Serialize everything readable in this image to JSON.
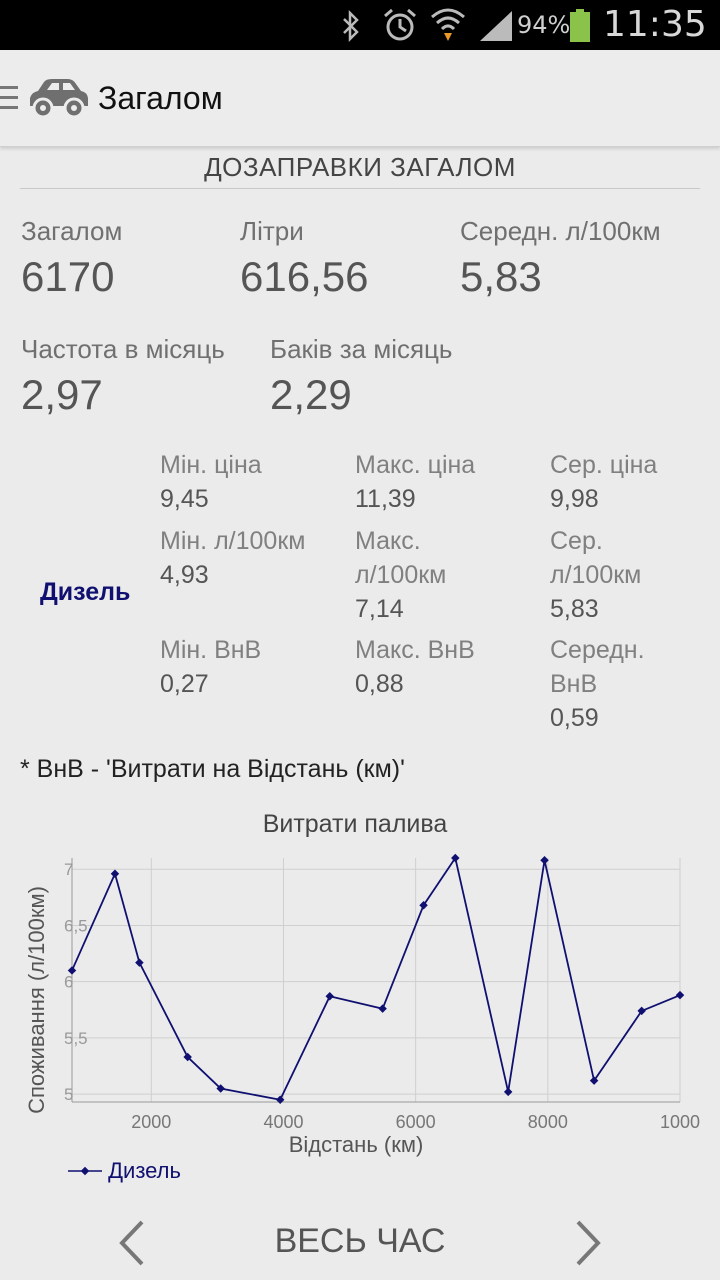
{
  "status_bar": {
    "icons": [
      "bluetooth-icon",
      "alarm-icon",
      "wifi-icon",
      "signal-icon",
      "battery-icon"
    ],
    "battery_percent": "94%",
    "time": "11:35",
    "battery_color": "#8bc34a"
  },
  "action_bar": {
    "title": "Загалом"
  },
  "summary": {
    "header": "ДОЗАПРАВКИ ЗАГАЛОМ",
    "stats": [
      {
        "label": "Загалом",
        "value": "6170"
      },
      {
        "label": "Літри",
        "value": "616,56"
      },
      {
        "label": "Середн. л/100км",
        "value": "5,83"
      },
      {
        "label": "Частота в місяць",
        "value": "2,97"
      },
      {
        "label": "Баків за місяць",
        "value": "2,29"
      }
    ]
  },
  "fuel": {
    "name": "Дизель",
    "name_color": "#101070",
    "cells": [
      {
        "label": "Мін. ціна",
        "value": "9,45"
      },
      {
        "label": "Макс. ціна",
        "value": "11,39"
      },
      {
        "label": "Сер. ціна",
        "value": "9,98"
      },
      {
        "label": "Мін. л/100км",
        "value": "4,93"
      },
      {
        "label": "Макс. л/100км",
        "value": "7,14"
      },
      {
        "label": "Сер. л/100км",
        "value": "5,83"
      },
      {
        "label": "Мін. ВнВ",
        "value": "0,27"
      },
      {
        "label": "Макс. ВнВ",
        "value": "0,88"
      },
      {
        "label": "Середн. ВнВ",
        "value": "0,59"
      }
    ]
  },
  "footnote": "* ВнВ - 'Витрати на Відстань (км)'",
  "chart_data": {
    "type": "line",
    "title": "Витрати палива",
    "xlabel": "Відстань (км)",
    "ylabel": "Споживання (л/100км)",
    "xlim": [
      800,
      10000
    ],
    "ylim": [
      4.93,
      7.1
    ],
    "x_ticks": [
      2000,
      4000,
      6000,
      8000,
      10000
    ],
    "x_tick_labels": [
      "2000",
      "4000",
      "6000",
      "8000",
      "1000"
    ],
    "y_ticks": [
      5,
      5.5,
      6,
      6.5,
      7
    ],
    "y_tick_labels": [
      "5",
      "5,5",
      "6",
      "6,5",
      "7"
    ],
    "grid": true,
    "legend": "bottom-left",
    "series": [
      {
        "name": "Дизель",
        "color": "#101070",
        "x": [
          800,
          1450,
          1820,
          2550,
          3050,
          3950,
          4700,
          5500,
          6120,
          6600,
          7400,
          7950,
          8700,
          9420,
          10000
        ],
        "y": [
          6.1,
          6.96,
          6.17,
          5.33,
          5.05,
          4.95,
          5.87,
          5.76,
          6.68,
          7.1,
          5.02,
          7.08,
          5.12,
          5.74,
          5.88
        ]
      }
    ]
  },
  "navigation": {
    "label": "ВЕСЬ ЧАС"
  }
}
